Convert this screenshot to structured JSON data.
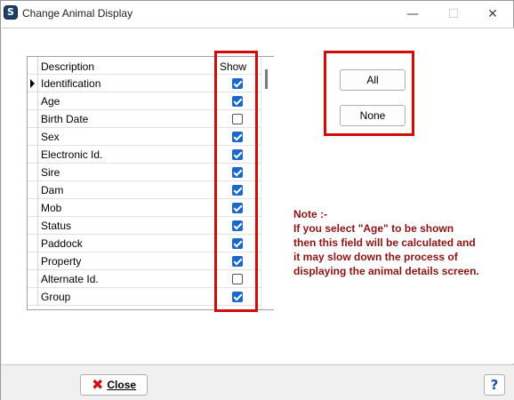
{
  "window": {
    "title": "Change Animal Display",
    "controls": {
      "minimize": "—",
      "maximize": "☐",
      "close": "✕"
    },
    "app_icon_glyph": "S"
  },
  "grid": {
    "headers": {
      "description": "Description",
      "show": "Show"
    },
    "rows": [
      {
        "label": "Identification",
        "checked": true,
        "current": true
      },
      {
        "label": "Age",
        "checked": true
      },
      {
        "label": "Birth Date",
        "checked": false
      },
      {
        "label": "Sex",
        "checked": true
      },
      {
        "label": "Electronic Id.",
        "checked": true
      },
      {
        "label": "Sire",
        "checked": true
      },
      {
        "label": "Dam",
        "checked": true
      },
      {
        "label": "Mob",
        "checked": true
      },
      {
        "label": "Status",
        "checked": true
      },
      {
        "label": "Paddock",
        "checked": true
      },
      {
        "label": "Property",
        "checked": true
      },
      {
        "label": "Alternate Id.",
        "checked": false
      },
      {
        "label": "Group",
        "checked": true
      }
    ]
  },
  "buttons": {
    "all": "All",
    "none": "None"
  },
  "note": {
    "lines": [
      "Note :-",
      "If you select \"Age\" to be shown",
      "then this field will be calculated and",
      "it may slow down the process of",
      "displaying the animal details screen."
    ]
  },
  "footer": {
    "close_label": "Close",
    "close_icon_glyph": "✖",
    "help_glyph": "?"
  },
  "colors": {
    "highlight_box": "#d10a0a",
    "note_text": "#8b1313",
    "checkbox_checked": "#1a68c8"
  }
}
